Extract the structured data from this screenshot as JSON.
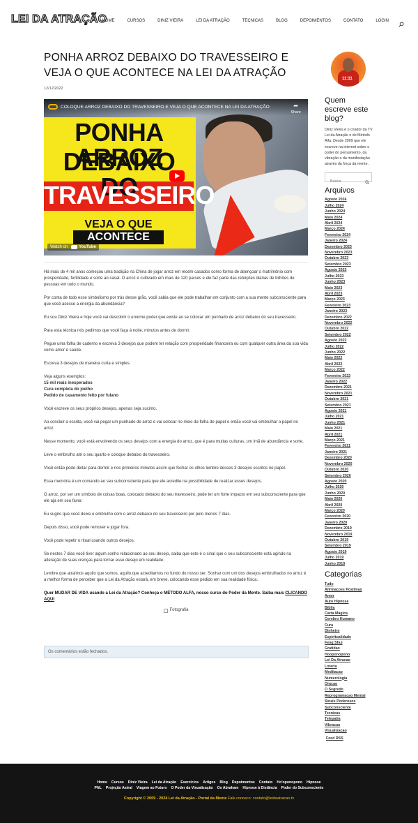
{
  "header": {
    "logo": "Lei da Atração",
    "nav": [
      "HOME",
      "CURSOS",
      "DINIZ VIEIRA",
      "LEI DA ATRAÇÃO",
      "TECNICAS",
      "BLOG",
      "DEPOIMENTOS",
      "CONTATO",
      "LOGIN"
    ]
  },
  "post": {
    "title": "PONHA ARROZ DEBAIXO DO TRAVESSEIRO E VEJA O QUE ACONTECE NA LEI DA ATRAÇÃO",
    "date": "12/12/2022",
    "video": {
      "title": "COLOQUE ARROZ DEBAIXO DO TRAVESSEIRO E VEJA O QUE ACONTECE NA LEI DA ATRAÇÃO",
      "share": "Share",
      "thumb_line1": "PONHA ARROZ",
      "thumb_line2": "DEBAIXO DO",
      "thumb_line3": "TRAVESSEIRO",
      "thumb_line4": "VEJA O QUE",
      "thumb_line5": "ACONTECE",
      "watch_on": "Watch on",
      "youtube": "YouTube"
    },
    "paragraphs": [
      "Há mais de 4 mil anos começou uma tradição na China de jogar arroz em recém casados como forma de abençoar o matrimônio com prosperidade, fertilidade e sorte ao casal. O arroz é cultivado em mais de 120 países e ele faz parte das refeições diárias de bilhões de pessoas em todo o mundo.",
      "Por conta de todo esse simbolismo por trás desse grão, você sabia que ele pode trabalhar em conjunto com a sua mente subconsciente para que você acesse a energia da abundância?",
      "Eu sou Diniz Vieira e hoje você vai descobrir o enorme poder que existe ao se colocar um punhado de arroz debaixo do seu travesseiro.",
      "Para esta técnica nós pedimos que você faça à noite, minutos antes de dormir.",
      "Pegue uma folha de caderno e escreva 3 desejos que podem ter relação com prosperidade financeira ou com qualquer outra área da sua vida como amor e saúde.",
      "Escreva 3 desejos de maneira curta e simples."
    ],
    "examples_intro": "Veja alguns exemplos:",
    "examples": [
      "15 mil reais inesperados",
      "Cura completa do joelho",
      "Pedido de casamento feito por fulano"
    ],
    "paragraphs2": [
      "Você escreve os seus próprios desejos, apenas seja sucinto.",
      "Ao concluir a escrita, você vai pegar um punhado de arroz e vai colocar no meio da folha de papel e então você vai embrulhar o papel no arroz.",
      "Nesse momento, você está envolvendo os seus desejos com a energia do arroz, que é para muitas culturas, um imã de abundância e sorte.",
      "Leve o embrulho até o seu quarto e coloque debaixo do travesseiro.",
      "Você então pode deitar para dormir e nos primeiros minutos assim que fechar os olhos lembre desses 3 desejos escritos no papel.",
      "Essa memória é um comando ao seu subconsciente para que ele acredite na possibilidade de realizar esses desejos.",
      "O arroz, por ser um símbolo de coisas boas, colocado debaixo do seu travesseiro, pode ter um forte impacto em seu subconsciente para que ele aja em seu favor.",
      "Eu sugiro que você deixe o embrulho com o arroz debaixo do seu travesseiro por pelo menos 7 dias.",
      "Depois disso, você pode remover e jogar fora.",
      "Você pode repetir o ritual usando outros desejos.",
      "Se nestes 7 dias você tiver algum sonho relacionado ao seu desejo, saiba que este é o sinal que o seu subconsciente está agindo na alteração de suas crenças para tornar esse desejo em realidade.",
      "Lembre que atraímos aquilo que somos, aquilo que acreditamos no fundo do nosso ser. Sonhar com um dos desejos embrulhados no arroz é a melhor forma de perceber que a Lei da Atração estará, em breve, colocando esse pedido em sua realidade física."
    ],
    "cta_text": "Quer MUDAR DE VIDA usando a Lei da Atração? Conheça o MÉTODO ALFA, nosso curso do Poder da Mente. Saiba mais",
    "cta_link": "CLICANDO AQUI",
    "photo_alt": "Fotografia",
    "comments_closed": "Os comentários estão fechados."
  },
  "sidebar": {
    "author_title": "Quem escreve este blog?",
    "author_badge": "11:11",
    "author_text": "Diniz Vieira é o criador da TV Lei da Atração e do Método Alfa. Desde 2009 que ele escreve na internet sobre o poder do pensamento, da vibração e da manifestação através da força da mente.",
    "search_placeholder": "Busca",
    "archives_title": "Arquivos",
    "archives": [
      "Agosto 2024",
      "Julho 2024",
      "Junho 2024",
      "Maio 2024",
      "Abril 2024",
      "Março 2024",
      "Fevereiro 2024",
      "Janeiro 2024",
      "Dezembro 2023",
      "Novembro 2023",
      "Outubro 2023",
      "Setembro 2023",
      "Agosto 2023",
      "Julho 2023",
      "Junho 2023",
      "Maio 2023",
      "Abril 2023",
      "Março 2023",
      "Fevereiro 2023",
      "Janeiro 2023",
      "Dezembro 2022",
      "Novembro 2022",
      "Outubro 2022",
      "Setembro 2022",
      "Agosto 2022",
      "Julho 2022",
      "Junho 2022",
      "Maio 2022",
      "Abril 2022",
      "Março 2022",
      "Fevereiro 2022",
      "Janeiro 2022",
      "Dezembro 2021",
      "Novembro 2021",
      "Outubro 2021",
      "Setembro 2021",
      "Agosto 2021",
      "Julho 2021",
      "Junho 2021",
      "Maio 2021",
      "Abril 2021",
      "Março 2021",
      "Fevereiro 2021",
      "Janeiro 2021",
      "Dezembro 2020",
      "Novembro 2020",
      "Outubro 2020",
      "Setembro 2020",
      "Agosto 2020",
      "Julho 2020",
      "Junho 2020",
      "Maio 2020",
      "Abril 2020",
      "Março 2020",
      "Fevereiro 2020",
      "Janeiro 2020",
      "Dezembro 2019",
      "Novembro 2019",
      "Outubro 2019",
      "Setembro 2019",
      "Agosto 2019",
      "Julho 2019",
      "Junho 2019"
    ],
    "categories_title": "Categorias",
    "categories": [
      "Tudo",
      "Afirmacoes Positivas",
      "Amor",
      "Auto Hipnose",
      "Bíblia",
      "Carta Magica",
      "Cerebro Humano",
      "Cura",
      "Dinheiro",
      "Espiritualidade",
      "Feng Shui",
      "Gratidao",
      "Hooponopono",
      "Lei Da Atracao",
      "Loteria",
      "Meditacao",
      "Numerologia",
      "Oracao",
      "O Segredo",
      "Reprogramacao Mental",
      "Sinais Poderosos",
      "Subconsciente",
      "Tecnicas",
      "Telepatia",
      "Vibracao",
      "Visualizacao"
    ],
    "feed": "Feed RSS"
  },
  "footer": {
    "links_row1": [
      "Home",
      "Cursos",
      "Diniz Vieira",
      "Lei da Atração",
      "Exercícios",
      "Artigos",
      "Blog",
      "Depoimentos",
      "Contato",
      "Ho'oponopono",
      "Hipnose"
    ],
    "links_row2": [
      "PNL",
      "Projeção Astral",
      "Viagem ao Futuro",
      "O Poder da Visualização",
      "Os Abraham",
      "Hipnose à Distância",
      "Poder do Subconsciente"
    ],
    "copyright": "Copyright © 2009 - 2024 Lei da Atração - Portal da Mente",
    "contact": "Fale conosco: contato@leidaatracao.tv"
  },
  "colors": {
    "footer_bg": "#141414",
    "accent_yellow": "#f0c419",
    "notice_bg": "#e8f0f6"
  }
}
